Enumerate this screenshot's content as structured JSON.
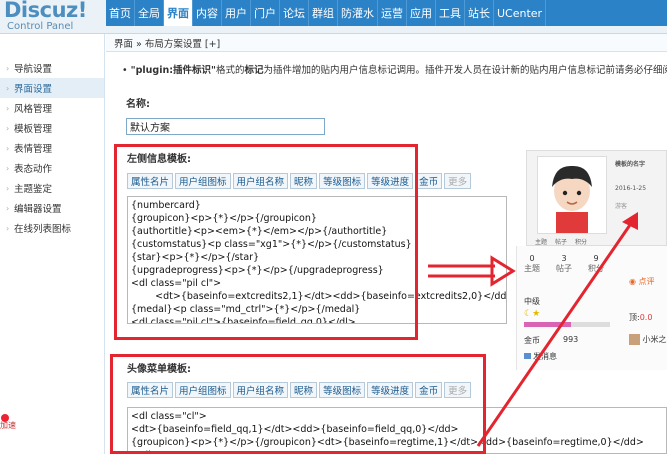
{
  "logo": {
    "brand": "Discuz!",
    "subtitle": "Control Panel"
  },
  "topnav": {
    "items": [
      "首页",
      "全局",
      "界面",
      "内容",
      "用户",
      "门户",
      "论坛",
      "群组",
      "防灌水",
      "运营",
      "应用",
      "工具",
      "站长",
      "UCenter"
    ],
    "active_index": 2
  },
  "breadcrumb": {
    "text": "界面 » 布局方案设置  [+]"
  },
  "sidebar": {
    "items": [
      "导航设置",
      "界面设置",
      "风格管理",
      "模板管理",
      "表情管理",
      "表态动作",
      "主题鉴定",
      "编辑器设置",
      "在线列表图标"
    ],
    "active_index": 1
  },
  "tip": {
    "bullet": "•",
    "bold_text": "\"plugin:插件标识\"",
    "text_a": "格式的",
    "bold_text2": "标记",
    "text_b": "为插件增加的贴内用户信息标记调用。插件开发人员在设计新的贴内用户信息标记前请务必仔细阅"
  },
  "scheme": {
    "label": "名称:",
    "value": "默认方案"
  },
  "left_template": {
    "label": "左侧信息模板:",
    "buttons": [
      "属性名片",
      "用户组图标",
      "用户组名称",
      "昵称",
      "等级图标",
      "等级进度",
      "金币",
      "更多"
    ],
    "code_lines": [
      "{numbercard}",
      "{groupicon}<p>{*}</p>{/groupicon}",
      "{authortitle}<p><em>{*}</em></p>{/authortitle}",
      "{customstatus}<p class=\"xg1\">{*}</p>{/customstatus}",
      "{star}<p>{*}</p>{/star}",
      "{upgradeprogress}<p>{*}</p>{/upgradeprogress}",
      "<dl class=\"pil cl\">",
      "        <dt>{baseinfo=extcredits2,1}</dt><dd>{baseinfo=extcredits2,0}</dd>",
      "{medal}<p class=\"md_ctrl\">{*}</p>{/medal}",
      "<dl class=\"pil cl\">{baseinfo=field_qq,0}</dl>"
    ]
  },
  "avatar_menu_template": {
    "label": "头像菜单模板:",
    "buttons": [
      "属性名片",
      "用户组图标",
      "用户组名称",
      "昵称",
      "等级图标",
      "等级进度",
      "金币",
      "更多"
    ],
    "code_lines": [
      "<dl class=\"cl\">",
      "<dt>{baseinfo=field_qq,1}</dt><dd>{baseinfo=field_qq,0}</dd>",
      "{groupicon}<p>{*}</p>{/groupicon}<dt>{baseinfo=regtime,1}</dt><dd>{baseinfo=regtime,0}</dd>",
      "</dl>"
    ]
  },
  "preview": {
    "name_line": "模板的名字",
    "date_line": "2016-1-25",
    "small_line": "游客",
    "tabs": [
      "主题",
      "帖子",
      "积分"
    ],
    "stats": [
      {
        "n": "0",
        "l": "主题"
      },
      {
        "n": "3",
        "l": "帖子"
      },
      {
        "n": "9",
        "l": "积分"
      }
    ],
    "level": "中级",
    "gold_label": "金币",
    "gold_value": "993",
    "message": "发消息",
    "rate": "点评",
    "top_text": "顶:",
    "top_value": "0.0",
    "user_text": "小米之"
  },
  "badge": {
    "text": "加速"
  },
  "colors": {
    "accent": "#2b82c7",
    "annotation": "#e2252f"
  }
}
